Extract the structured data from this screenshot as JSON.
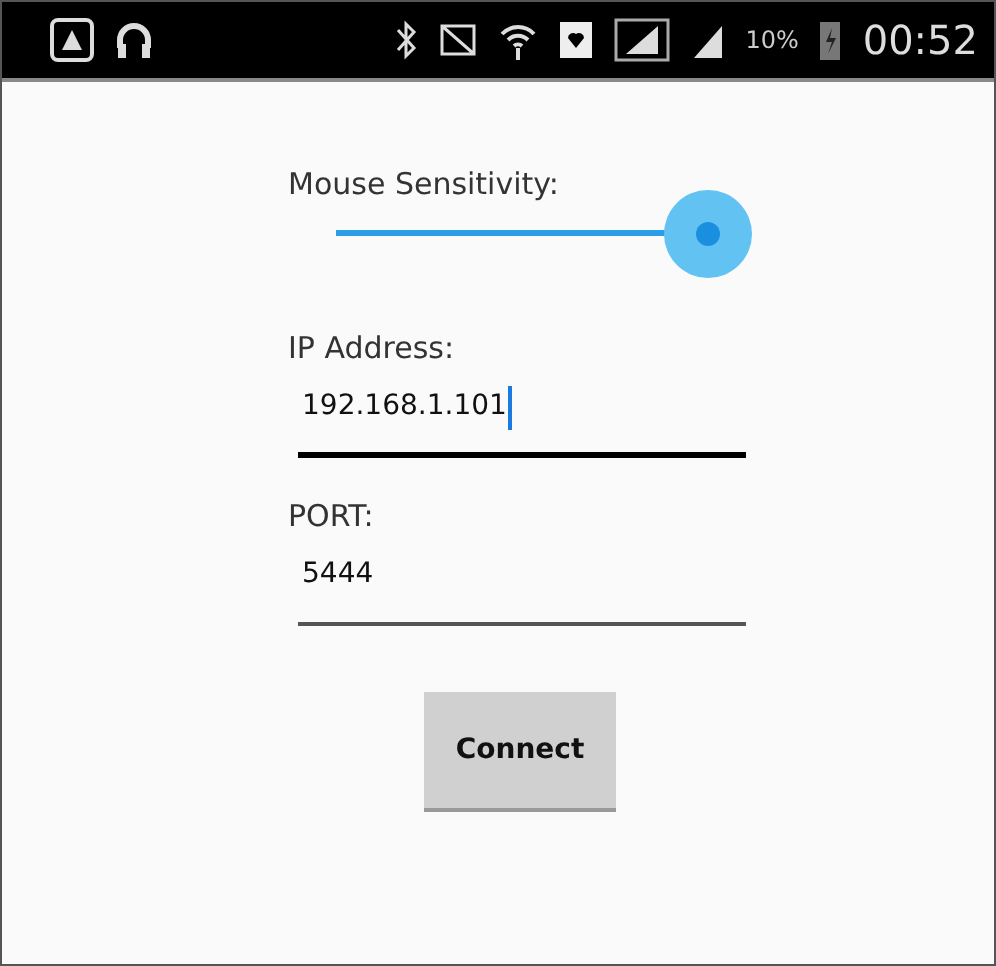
{
  "status_bar": {
    "battery": "10%",
    "time": "00:52"
  },
  "sensitivity": {
    "label": "Mouse Sensitivity:",
    "level": 1
  },
  "fields": [
    {
      "label": "IP Address:",
      "value": "192.168.1.101",
      "focused": true
    },
    {
      "label": "PORT:",
      "value": "5444",
      "focused": false
    }
  ],
  "button": "Connect"
}
